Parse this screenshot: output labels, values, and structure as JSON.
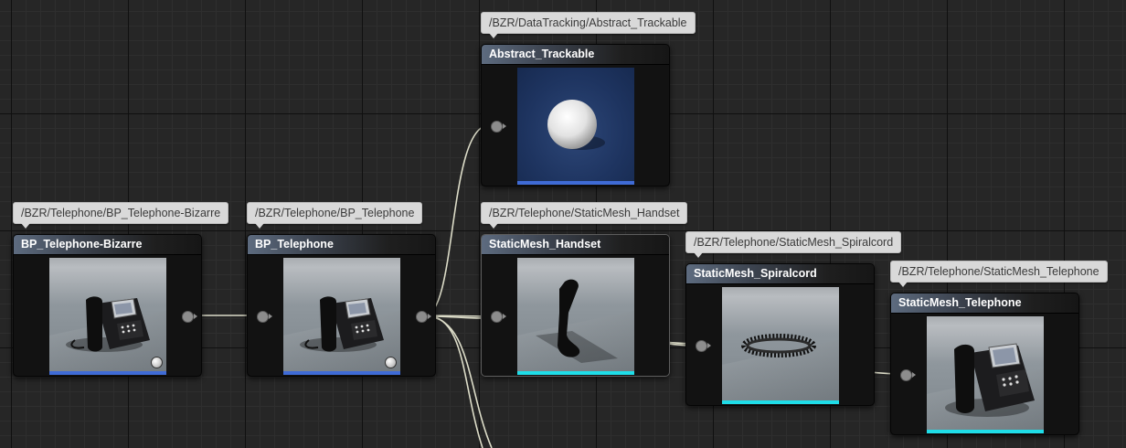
{
  "nodes": {
    "bp_bizarre": {
      "path": "/BZR/Telephone/BP_Telephone-Bizarre",
      "title": "BP_Telephone-Bizarre",
      "bar_color": "#3f6bd6",
      "thumb_icon": "desk-phone-icon"
    },
    "bp_telephone": {
      "path": "/BZR/Telephone/BP_Telephone",
      "title": "BP_Telephone",
      "bar_color": "#3f6bd6",
      "thumb_icon": "desk-phone-icon"
    },
    "abstract_trackable": {
      "path": "/BZR/DataTracking/Abstract_Trackable",
      "title": "Abstract_Trackable",
      "bar_color": "#3f6bd6",
      "thumb_icon": "sphere-icon"
    },
    "handset": {
      "path": "/BZR/Telephone/StaticMesh_Handset",
      "title": "StaticMesh_Handset",
      "bar_color": "#1fdde8",
      "thumb_icon": "handset-icon"
    },
    "spiralcord": {
      "path": "/BZR/Telephone/StaticMesh_Spiralcord",
      "title": "StaticMesh_Spiralcord",
      "bar_color": "#1fdde8",
      "thumb_icon": "spiral-cord-icon"
    },
    "telephone": {
      "path": "/BZR/Telephone/StaticMesh_Telephone",
      "title": "StaticMesh_Telephone",
      "bar_color": "#1fdde8",
      "thumb_icon": "desk-phone-icon"
    }
  },
  "wire_color": "#dcdcc8"
}
